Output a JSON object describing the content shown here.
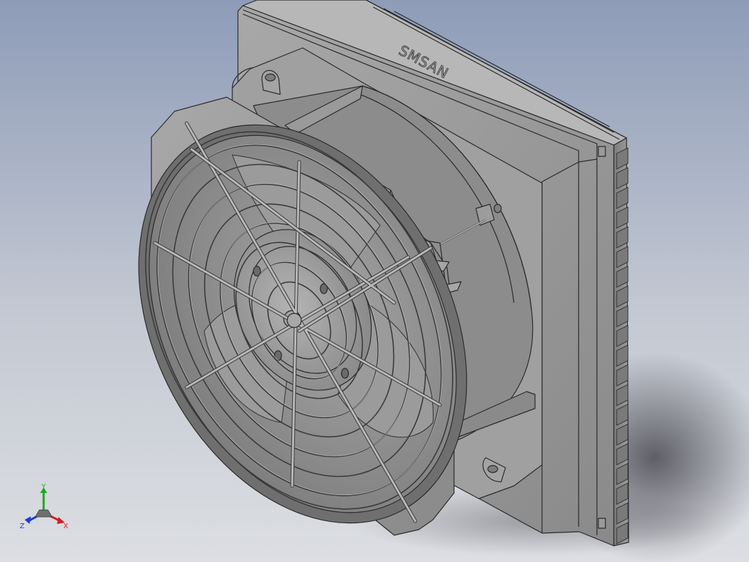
{
  "viewport": {
    "background_top": "#8e9cb8",
    "background_mid": "#c3c8d2",
    "background_bottom": "#dcdee2"
  },
  "model": {
    "brand_text": "SMSAN",
    "body_color": "#9a9a9a",
    "edge_color": "#2a2a2a"
  },
  "triad": {
    "x_label": "X",
    "y_label": "Y",
    "z_label": "Z",
    "x_color": "#d21e1e",
    "y_color": "#22a622",
    "z_color": "#1e3cd2"
  }
}
